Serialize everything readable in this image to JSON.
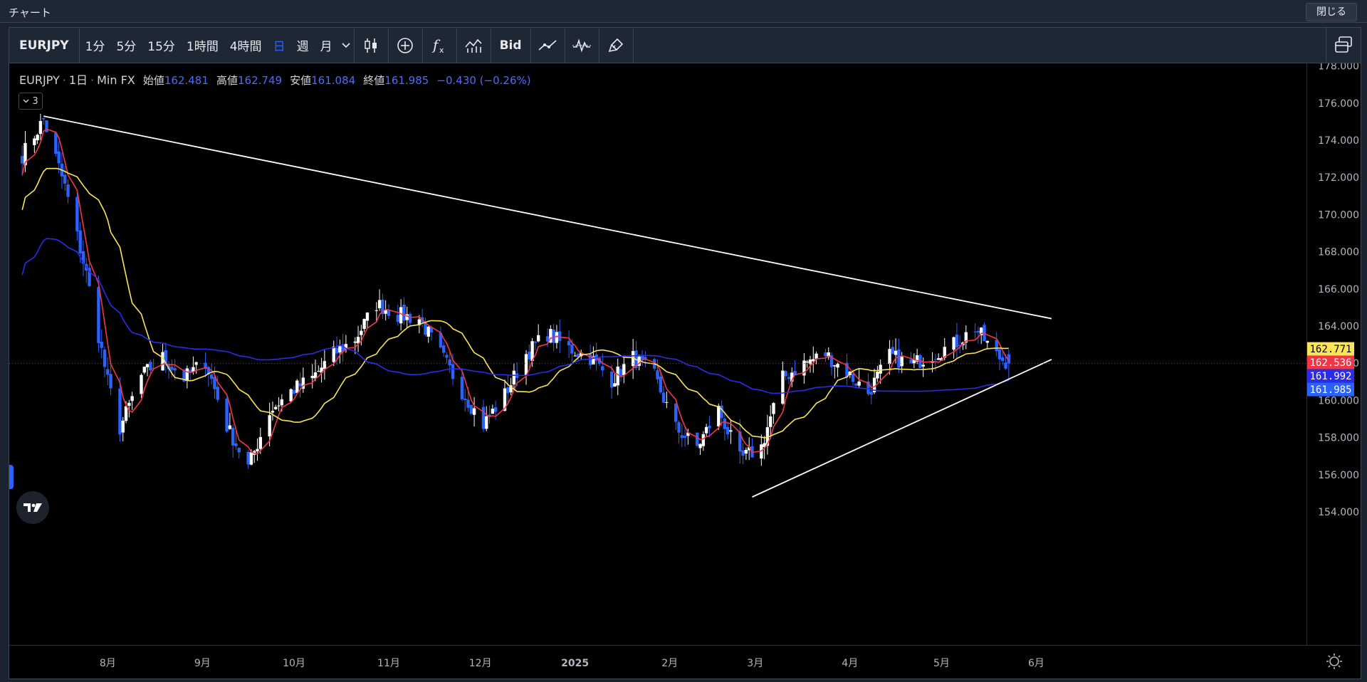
{
  "window": {
    "title": "チャート",
    "close_label": "閉じる"
  },
  "toolbar": {
    "symbol": "EURJPY",
    "intervals": [
      "1分",
      "5分",
      "15分",
      "1時間",
      "4時間",
      "日",
      "週",
      "月"
    ],
    "active_interval": "日",
    "bid_label": "Bid",
    "icons": [
      "chevron-down-icon",
      "candlestick-icon",
      "add-circle-icon",
      "function-icon",
      "indicator-icon",
      "trendline-icon",
      "oscillator-icon",
      "brush-icon",
      "layout-icon"
    ]
  },
  "legend": {
    "symbol": "EURJPY",
    "interval": "1日",
    "source": "Min FX",
    "open_label": "始値",
    "open": "162.481",
    "high_label": "高値",
    "high": "162.749",
    "low_label": "安値",
    "low": "161.084",
    "close_label": "終値",
    "close": "161.985",
    "change": "−0.430 (−0.26%)",
    "indicator_count": "3"
  },
  "colors": {
    "up": "#ffffff",
    "down": "#2962ff",
    "ma_fast": "#f23645",
    "ma_mid": "#fbe35a",
    "ma_slow": "#2b2be8",
    "trendline": "#ffffff",
    "background": "#000000"
  },
  "chart_data": {
    "type": "candlestick",
    "ylim": [
      153.0,
      178.0
    ],
    "yticks": [
      "154.000",
      "156.000",
      "158.000",
      "160.000",
      "162.000",
      "164.000",
      "166.000",
      "168.000",
      "170.000",
      "172.000",
      "174.000",
      "176.000",
      "178.000"
    ],
    "x_labels": [
      "8月",
      "9月",
      "10月",
      "11月",
      "12月",
      "2025",
      "2月",
      "3月",
      "4月",
      "5月",
      "6月"
    ],
    "price_badges": [
      {
        "value": "162.771",
        "color": "#fbe35a",
        "text_color": "#000000"
      },
      {
        "value": "162.536",
        "color": "#f23645",
        "text_color": "#ffffff"
      },
      {
        "value": "161.992",
        "color": "#2b2be8",
        "text_color": "#ffffff"
      },
      {
        "value": "161.985",
        "color": "#2962ff",
        "text_color": "#ffffff"
      }
    ],
    "anchors": [
      [
        "2024-07-04",
        173.2
      ],
      [
        "2024-07-11",
        175.1
      ],
      [
        "2024-07-18",
        171.5
      ],
      [
        "2024-07-25",
        166.8
      ],
      [
        "2024-08-01",
        161.0
      ],
      [
        "2024-08-05",
        158.5
      ],
      [
        "2024-08-12",
        161.3
      ],
      [
        "2024-08-19",
        162.3
      ],
      [
        "2024-08-26",
        161.2
      ],
      [
        "2024-09-02",
        162.1
      ],
      [
        "2024-09-09",
        158.6
      ],
      [
        "2024-09-16",
        156.4
      ],
      [
        "2024-09-23",
        159.4
      ],
      [
        "2024-09-30",
        160.5
      ],
      [
        "2024-10-07",
        161.2
      ],
      [
        "2024-10-14",
        162.5
      ],
      [
        "2024-10-21",
        163.3
      ],
      [
        "2024-10-28",
        165.2
      ],
      [
        "2024-11-04",
        164.6
      ],
      [
        "2024-11-11",
        164.4
      ],
      [
        "2024-11-18",
        162.5
      ],
      [
        "2024-11-25",
        160.5
      ],
      [
        "2024-12-02",
        158.7
      ],
      [
        "2024-12-09",
        160.3
      ],
      [
        "2024-12-16",
        162.5
      ],
      [
        "2024-12-23",
        163.6
      ],
      [
        "2024-12-30",
        162.8
      ],
      [
        "2025-01-06",
        162.3
      ],
      [
        "2025-01-13",
        161.1
      ],
      [
        "2025-01-20",
        162.3
      ],
      [
        "2025-01-27",
        161.3
      ],
      [
        "2025-02-03",
        158.5
      ],
      [
        "2025-02-10",
        157.5
      ],
      [
        "2025-02-17",
        159.5
      ],
      [
        "2025-02-24",
        156.8
      ],
      [
        "2025-03-03",
        157.5
      ],
      [
        "2025-03-10",
        161.2
      ],
      [
        "2025-03-17",
        162.0
      ],
      [
        "2025-03-24",
        162.5
      ],
      [
        "2025-03-31",
        161.5
      ],
      [
        "2025-04-07",
        160.4
      ],
      [
        "2025-04-14",
        162.4
      ],
      [
        "2025-04-21",
        161.9
      ],
      [
        "2025-04-28",
        162.5
      ],
      [
        "2025-05-05",
        163.0
      ],
      [
        "2025-05-12",
        163.9
      ],
      [
        "2025-05-19",
        162.4
      ],
      [
        "2025-05-23",
        162.0
      ]
    ],
    "trendlines": [
      {
        "from": [
          "2024-07-11",
          175.3
        ],
        "to": [
          "2025-06-06",
          164.4
        ]
      },
      {
        "from": [
          "2025-02-28",
          154.8
        ],
        "to": [
          "2025-06-06",
          162.2
        ]
      }
    ],
    "moving_averages": [
      {
        "period": 5,
        "color": "#f23645"
      },
      {
        "period": 20,
        "color": "#fbe35a"
      },
      {
        "period": 75,
        "color": "#2b2be8"
      }
    ]
  }
}
